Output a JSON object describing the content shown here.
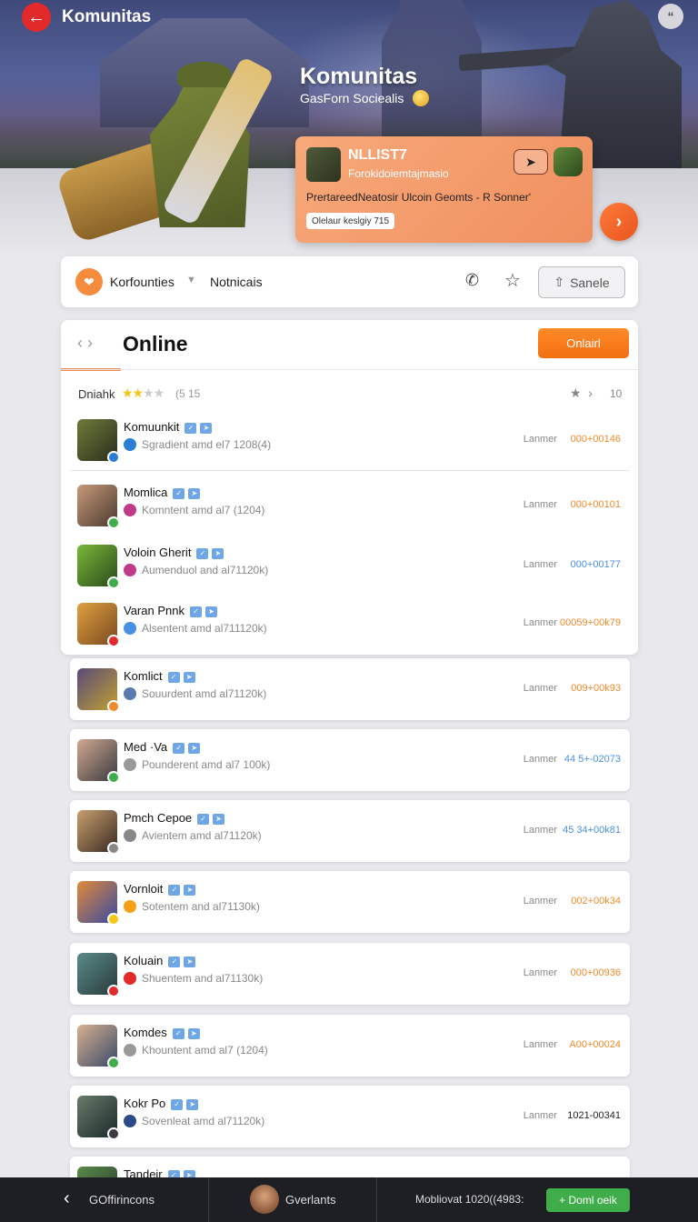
{
  "topbar": {
    "title": "Komunitas"
  },
  "hero": {
    "title": "Komunitas",
    "subtitle": "GasForn Sociealis"
  },
  "promo": {
    "name": "NLLIST7",
    "subtitle": "Forokidoiemtajmasio",
    "description": "PrertareedNeatosir Ulcoin Geomts - R Sonner'",
    "tag": "Olelaur keslgiy 715"
  },
  "nav": {
    "item1": "Korfounties",
    "item2": "Notnicais",
    "share_label": "Sanele"
  },
  "panel": {
    "title": "Online",
    "button": "Onlairl",
    "filter_label": "Dniahk",
    "filter_count": "(5 15",
    "filter_num": "10",
    "rating": {
      "value": 2,
      "max": 5
    }
  },
  "rows": [
    {
      "name": "Komuunkit",
      "meta": "Sgradient amd el7 1208(4)",
      "label": "Lanmer",
      "value": "000+00146",
      "value_color": "orange"
    },
    {
      "name": "Momlica",
      "meta": "Komntent amd al7 (1204)",
      "label": "Lanmer",
      "value": "000+00101",
      "value_color": "orange"
    },
    {
      "name": "Voloin Gherit",
      "meta": "Aumenduol and al71120k)",
      "label": "Lanmer",
      "value": "000+00177",
      "value_color": "blue"
    },
    {
      "name": "Varan Pnnk",
      "meta": "Alsentent amd al711120k)",
      "label": "Lanmer",
      "value": "00059+00k79",
      "value_color": "orange"
    },
    {
      "name": "Komlict",
      "meta": "Souurdent amd al71120k)",
      "label": "Lanmer",
      "value": "009+00k93",
      "value_color": "orange"
    },
    {
      "name": "Med ·Va",
      "meta": "Pounderent amd al7 100k)",
      "label": "Lanmer",
      "value": "44 5+-02073",
      "value_color": "blue"
    },
    {
      "name": "Pmch Cepoe",
      "meta": "Avientem amd al71120k)",
      "label": "Lanmer",
      "value": "45 34+00k81",
      "value_color": "blue"
    },
    {
      "name": "Vornloit",
      "meta": "Sotentem and al71130k)",
      "label": "Lanmer",
      "value": "002+00k34",
      "value_color": "orange"
    },
    {
      "name": "Koluain",
      "meta": "Shuentem and al71130k)",
      "label": "Lanmer",
      "value": "000+00936",
      "value_color": "orange"
    },
    {
      "name": "Komdes",
      "meta": "Khountent amd al7 (1204)",
      "label": "Lanmer",
      "value": "A00+00024",
      "value_color": "orange"
    },
    {
      "name": "Kokr Po",
      "meta": "Sovenleat amd al71120k)",
      "label": "Lanmer",
      "value": "1021-00341",
      "value_color": "gray"
    },
    {
      "name": "Tandeir",
      "meta": "",
      "label": "",
      "value": "",
      "value_color": "gray"
    }
  ],
  "bottombar": {
    "back_label": "GOffirincons",
    "user_label": "Gverlants",
    "status": "Mobliovat 1020((4983:",
    "cta": "+ Doml oeik"
  },
  "colors": {
    "accent": "#f26f10",
    "link_blue": "#4a90e2",
    "cta_green": "#3fae4a",
    "back_red": "#e22a2a"
  }
}
